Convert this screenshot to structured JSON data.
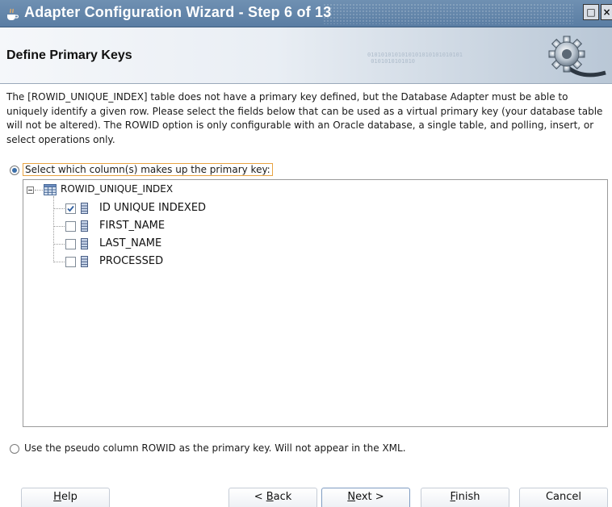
{
  "window": {
    "title": "Adapter Configuration Wizard - Step 6 of 13",
    "restore_label": "□",
    "close_label": "×"
  },
  "header": {
    "title": "Define Primary Keys",
    "binary_deco": "0101010101010101010101010101\n 0101010101010"
  },
  "description": "The [ROWID_UNIQUE_INDEX] table does not have a primary key defined, but the Database Adapter must be able to uniquely identify a given row.  Please select the fields below that can be used as a virtual primary key (your database table will not be altered).  The ROWID option is only configurable with an Oracle database, a single table, and polling, insert, or select operations only.",
  "options": {
    "select_columns": {
      "label": "Select which column(s) makes up the primary key:",
      "selected": true
    },
    "use_rowid": {
      "label": "Use the pseudo column ROWID as the primary key.  Will not appear in the XML.",
      "selected": false
    }
  },
  "tree": {
    "table_name": "ROWID_UNIQUE_INDEX",
    "columns": [
      {
        "name": "ID UNIQUE INDEXED",
        "checked": true
      },
      {
        "name": "FIRST_NAME",
        "checked": false
      },
      {
        "name": "LAST_NAME",
        "checked": false
      },
      {
        "name": "PROCESSED",
        "checked": false
      }
    ]
  },
  "buttons": {
    "help": {
      "mnemonic": "H",
      "rest": "elp"
    },
    "back": {
      "prefix": "< ",
      "mnemonic": "B",
      "rest": "ack"
    },
    "next": {
      "mnemonic": "N",
      "rest": "ext >"
    },
    "finish": {
      "mnemonic": "F",
      "rest": "inish"
    },
    "cancel": "Cancel"
  },
  "colors": {
    "titlebar": "#5f82a8",
    "accent": "#3c6fa9",
    "focus": "#e8a342"
  }
}
